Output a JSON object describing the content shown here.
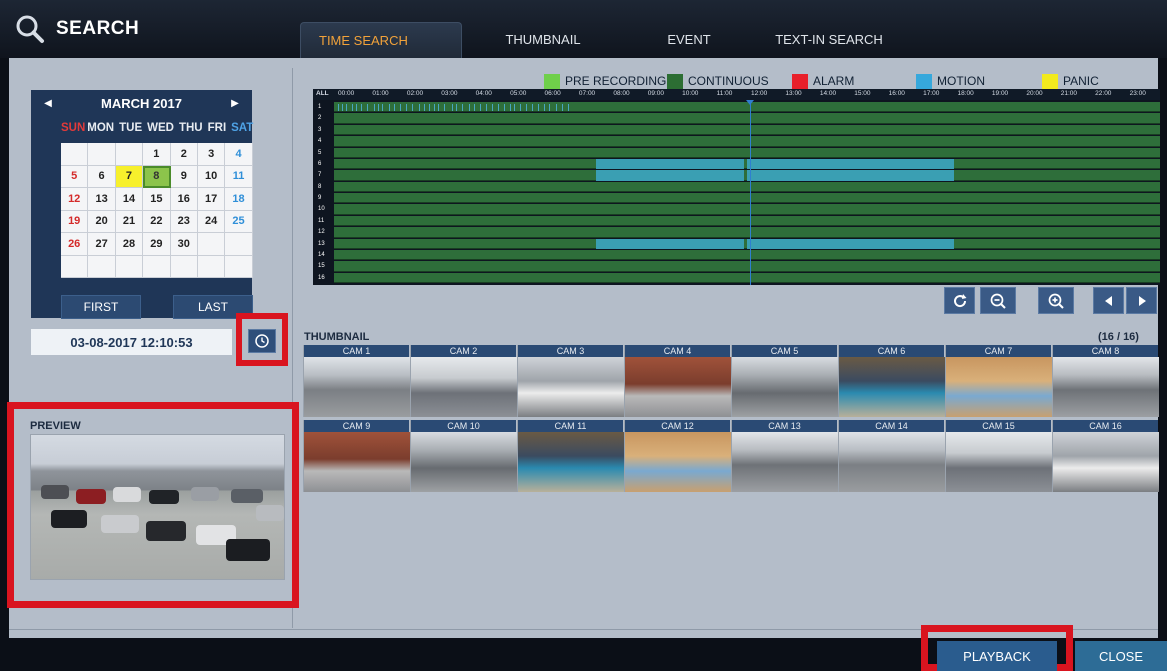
{
  "header": {
    "title": "SEARCH",
    "search_icon": "magnifier-icon"
  },
  "tabs": [
    {
      "label": "TIME SEARCH",
      "active": true
    },
    {
      "label": "THUMBNAIL SEARCH",
      "active": false
    },
    {
      "label": "EVENT SEARCH",
      "active": false
    },
    {
      "label": "TEXT-IN SEARCH",
      "active": false
    }
  ],
  "calendar": {
    "month": "MARCH 2017",
    "weekdays": [
      "SUN",
      "MON",
      "TUE",
      "WED",
      "THU",
      "FRI",
      "SAT"
    ],
    "weeks": [
      [
        "",
        "",
        "",
        "1",
        "2",
        "3",
        "4"
      ],
      [
        "5",
        "6",
        "7",
        "8",
        "9",
        "10",
        "11"
      ],
      [
        "12",
        "13",
        "14",
        "15",
        "16",
        "17",
        "18"
      ],
      [
        "19",
        "20",
        "21",
        "22",
        "23",
        "24",
        "25"
      ],
      [
        "26",
        "27",
        "28",
        "29",
        "30",
        "",
        ""
      ],
      [
        "",
        "",
        "",
        "",
        "",
        "",
        ""
      ]
    ],
    "highlight_yellow": "7",
    "selected": "8",
    "first_label": "FIRST",
    "last_label": "LAST"
  },
  "datetime": "03-08-2017 12:10:53",
  "preview_label": "PREVIEW",
  "legend": [
    {
      "label": "PRE RECORDING",
      "color": "#6fcf4a"
    },
    {
      "label": "CONTINUOUS",
      "color": "#2c6e33"
    },
    {
      "label": "ALARM",
      "color": "#e8202a"
    },
    {
      "label": "MOTION",
      "color": "#36a8dc"
    },
    {
      "label": "PANIC",
      "color": "#f2ea1d"
    }
  ],
  "timeline": {
    "all_label": "ALL",
    "hours": [
      "00:00",
      "01:00",
      "02:00",
      "03:00",
      "04:00",
      "05:00",
      "06:00",
      "07:00",
      "08:00",
      "09:00",
      "10:00",
      "11:00",
      "12:00",
      "13:00",
      "14:00",
      "15:00",
      "16:00",
      "17:00",
      "18:00",
      "19:00",
      "20:00",
      "21:00",
      "22:00",
      "23:00"
    ],
    "channels": [
      "1",
      "2",
      "3",
      "4",
      "5",
      "6",
      "7",
      "8",
      "9",
      "10",
      "11",
      "12",
      "13",
      "14",
      "15",
      "16"
    ],
    "motion_rows": [
      6,
      7,
      13
    ],
    "motion_start_hour": 7.6,
    "motion_gap_hour": 11.9,
    "motion_end_hour": 18.0,
    "cursor_hour": 12.1,
    "colors": {
      "continuous": "#2e6e3a",
      "motion": "#3a9fb3"
    }
  },
  "timeline_controls": [
    {
      "name": "refresh-icon"
    },
    {
      "name": "zoom-out-icon"
    },
    {
      "name": "zoom-in-icon"
    },
    {
      "name": "arrow-left-icon"
    },
    {
      "name": "arrow-right-icon"
    }
  ],
  "thumbnail": {
    "label": "THUMBNAIL",
    "count": "(16 / 16)",
    "cams": [
      "CAM 1",
      "CAM 2",
      "CAM 3",
      "CAM 4",
      "CAM 5",
      "CAM 6",
      "CAM 7",
      "CAM 8",
      "CAM 9",
      "CAM 10",
      "CAM 11",
      "CAM 12",
      "CAM 13",
      "CAM 14",
      "CAM 15",
      "CAM 16"
    ]
  },
  "buttons": {
    "playback": "PLAYBACK",
    "close": "CLOSE"
  }
}
